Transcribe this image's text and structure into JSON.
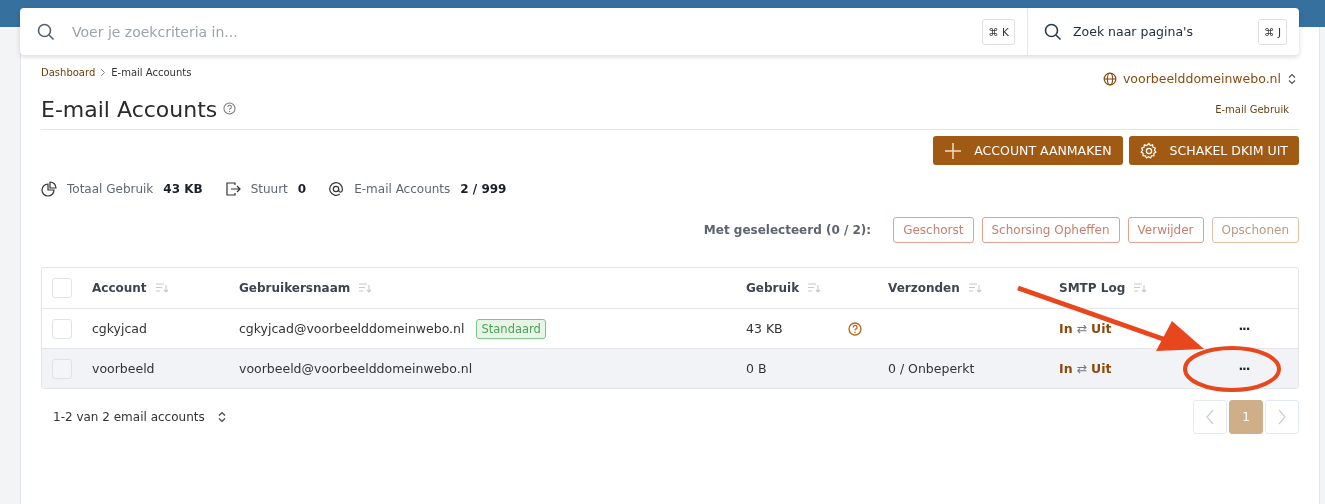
{
  "search": {
    "placeholder": "Voer je zoekcriteria in...",
    "shortcut": "⌘ K"
  },
  "page_search": {
    "label": "Zoek naar pagina's",
    "shortcut": "⌘ J"
  },
  "breadcrumb": [
    {
      "label": "Dashboard",
      "link": true
    },
    {
      "label": "E-mail Accounts",
      "link": false
    }
  ],
  "domain": "voorbeelddomeinwebo.nl",
  "title": "E-mail Accounts",
  "usage_link": "E-mail Gebruik",
  "buttons": [
    {
      "kind": "add",
      "label": "ACCOUNT AANMAKEN"
    },
    {
      "kind": "settings",
      "label": "SCHAKEL DKIM UIT"
    }
  ],
  "stats": [
    {
      "kind": "usage",
      "label": "Totaal Gebruik",
      "value": "43 KB"
    },
    {
      "kind": "send",
      "label": "Stuurt",
      "value": "0"
    },
    {
      "kind": "accounts",
      "label": "E-mail Accounts",
      "value": "2 / 999"
    }
  ],
  "bulk": {
    "label": "Met geselecteerd (0 / 2):",
    "actions": [
      {
        "label": "Geschorst",
        "disabled": false
      },
      {
        "label": "Schorsing Opheffen",
        "disabled": false
      },
      {
        "label": "Verwijder",
        "disabled": false
      },
      {
        "label": "Opschonen",
        "disabled": true
      }
    ]
  },
  "table": {
    "select_all": false,
    "columns": [
      "Account",
      "Gebruikersnaam",
      "Gebruik",
      "Verzonden",
      "SMTP Log"
    ],
    "rows": [
      {
        "checked": false,
        "highlighted": false,
        "account": "cgkyjcad",
        "username": "cgkyjcad@voorbeelddomeinwebo.nl",
        "badge": "Standaard",
        "usage": "43 KB",
        "usage_help": true,
        "smtp_in": "In",
        "smtp_arrow": "⇄",
        "smtp_out": "Uit",
        "menu": "···"
      },
      {
        "checked": false,
        "highlighted": true,
        "account": "voorbeeld",
        "username": "voorbeeld@voorbeelddomeinwebo.nl",
        "usage": "0 B",
        "usage_help": false,
        "sent": "0 / Onbeperkt",
        "smtp_in": "In",
        "smtp_arrow": "⇄",
        "smtp_out": "Uit",
        "menu": "···"
      }
    ]
  },
  "pagination": {
    "range": "1-2 van 2 email accounts",
    "pages": [
      {
        "label": "1",
        "selected": true
      }
    ]
  }
}
